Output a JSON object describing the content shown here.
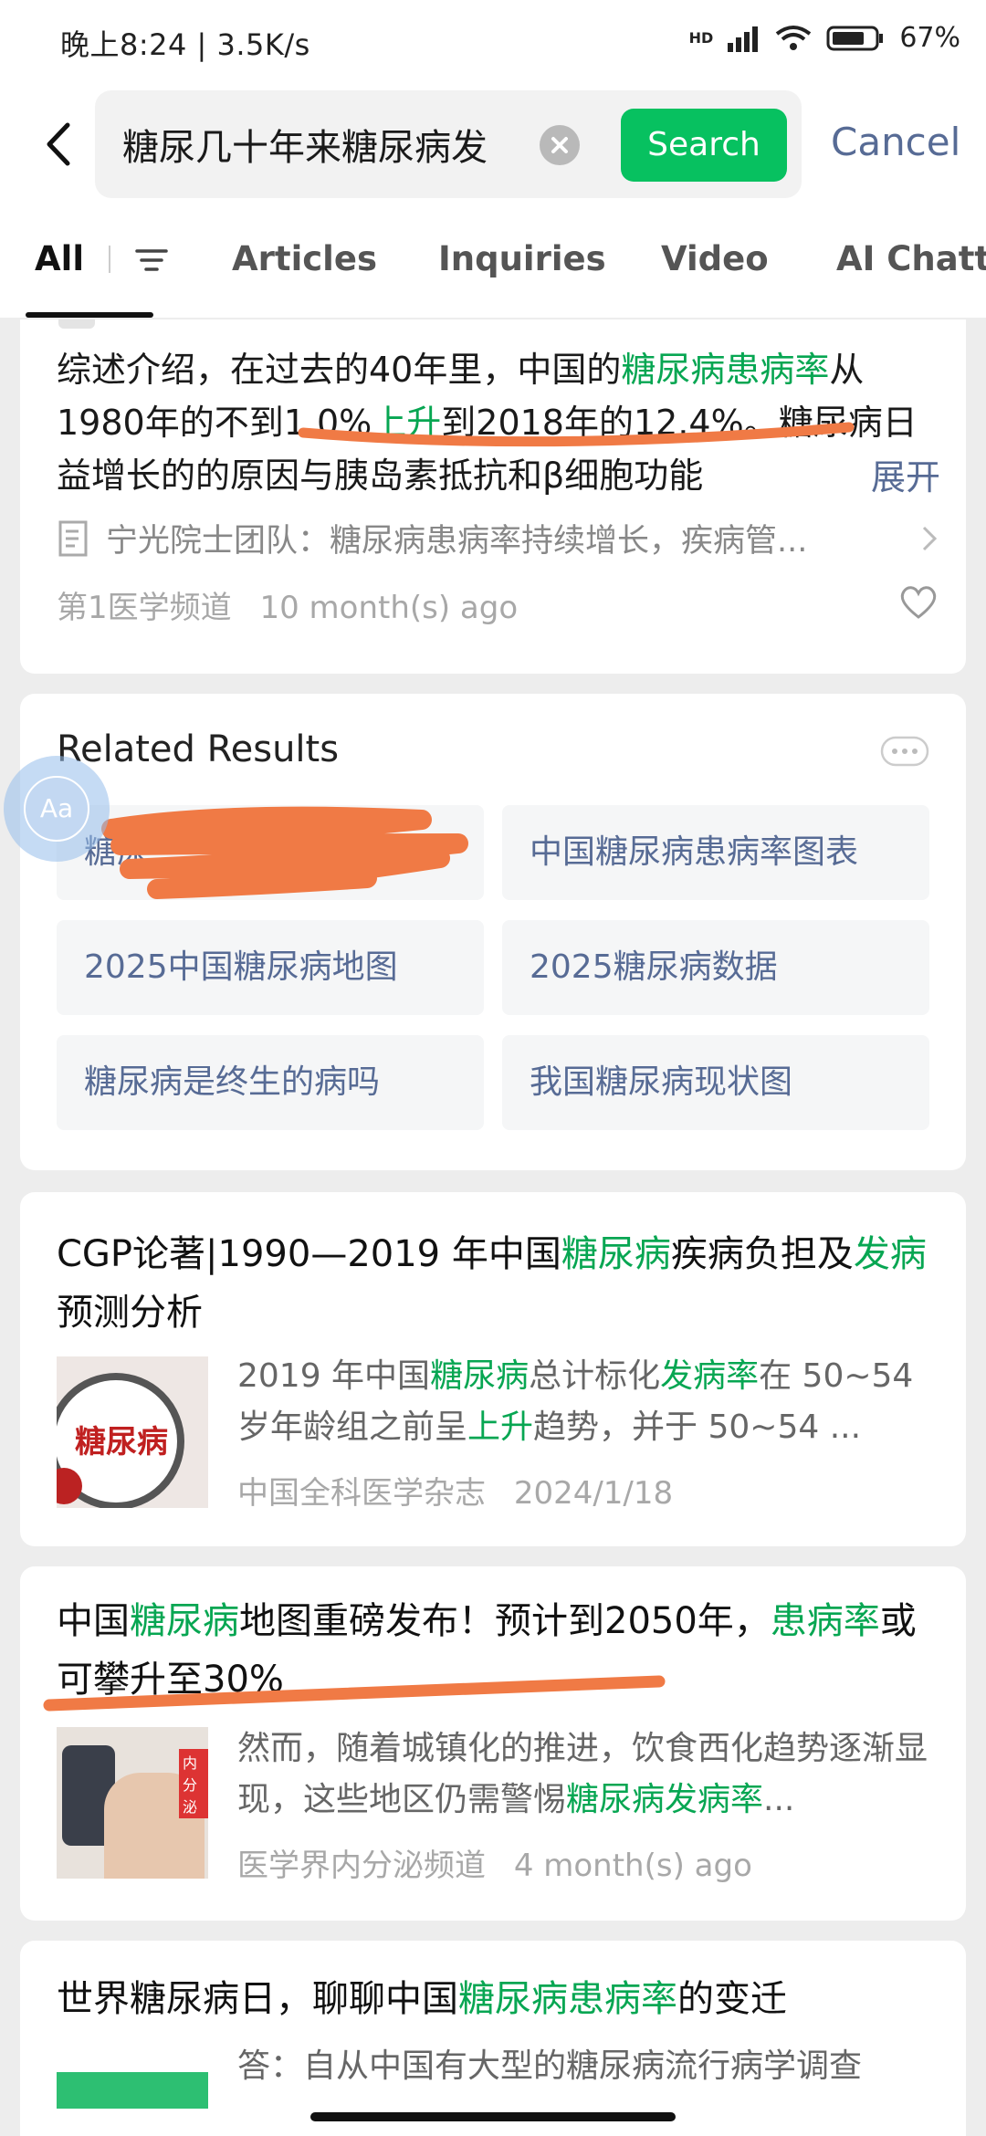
{
  "status_bar": {
    "left": "晚上8:24 | 3.5K/s",
    "right": "67%",
    "network": "HD"
  },
  "search": {
    "query": "糖尿几十年来糖尿病发",
    "button": "Search",
    "cancel": "Cancel"
  },
  "tabs": [
    "All",
    "Articles",
    "Inquiries",
    "Video",
    "AI Chattin"
  ],
  "card1": {
    "snippet_parts": [
      {
        "t": "综述介绍，在过去的40年里，中国的",
        "hl": false
      },
      {
        "t": "糖尿病患病率",
        "hl": true
      },
      {
        "t": "从1980年的不到1.0%",
        "hl": false
      },
      {
        "t": "上升",
        "hl": true
      },
      {
        "t": "到2018年的12.4%。糖尿病日益增长的的原因与胰岛素抵抗和β细胞功能",
        "hl": false
      }
    ],
    "expand": "展开",
    "source_article": "宁光院士团队：糖尿病患病率持续增长，疾病管...",
    "source": "第1医学频道",
    "time": "10 month(s) ago"
  },
  "related": {
    "title": "Related Results",
    "items": [
      "糖尿…",
      "中国糖尿病患病率图表",
      "2025中国糖尿病地图",
      "2025糖尿病数据",
      "糖尿病是终生的病吗",
      "我国糖尿病现状图"
    ]
  },
  "result1": {
    "title_parts": [
      {
        "t": "CGP论著|1990—2019 年中国",
        "hl": false
      },
      {
        "t": "糖尿病",
        "hl": true
      },
      {
        "t": "疾病负担及",
        "hl": false
      },
      {
        "t": "发病",
        "hl": true
      },
      {
        "t": "预测分析",
        "hl": false
      }
    ],
    "thumb_text": "糖尿病",
    "snippet_parts": [
      {
        "t": "2019 年中国",
        "hl": false
      },
      {
        "t": "糖尿病",
        "hl": true
      },
      {
        "t": "总计标化",
        "hl": false
      },
      {
        "t": "发病率",
        "hl": true
      },
      {
        "t": "在 50~54 岁年龄组之前呈",
        "hl": false
      },
      {
        "t": "上升",
        "hl": true
      },
      {
        "t": "趋势，并于 50~54 ...",
        "hl": false
      }
    ],
    "source": "中国全科医学杂志",
    "time": "2024/1/18"
  },
  "result2": {
    "title_parts": [
      {
        "t": "中国",
        "hl": false
      },
      {
        "t": "糖尿病",
        "hl": true
      },
      {
        "t": "地图重磅发布！预计到2050年，",
        "hl": false
      },
      {
        "t": "患病率",
        "hl": true
      },
      {
        "t": "或可攀升至30%",
        "hl": false
      }
    ],
    "thumb_label": "内分泌",
    "snippet_parts": [
      {
        "t": "然而，随着城镇化的推进，饮食西化趋势逐渐显现，这些地区仍需警惕",
        "hl": false
      },
      {
        "t": "糖尿病发病率",
        "hl": true
      },
      {
        "t": "...",
        "hl": false
      }
    ],
    "source": "医学界内分泌频道",
    "time": "4 month(s) ago"
  },
  "result3": {
    "title_parts": [
      {
        "t": "世界糖尿病日，聊聊中国",
        "hl": false
      },
      {
        "t": "糖尿病患病率",
        "hl": true
      },
      {
        "t": "的变迁",
        "hl": false
      }
    ],
    "snippet": "答：自从中国有大型的糖尿病流行病学调查"
  },
  "colors": {
    "accent_green": "#07c160",
    "link_blue": "#576b95",
    "annotation_orange": "#f07a45"
  },
  "floating": {
    "label": "Aa"
  }
}
